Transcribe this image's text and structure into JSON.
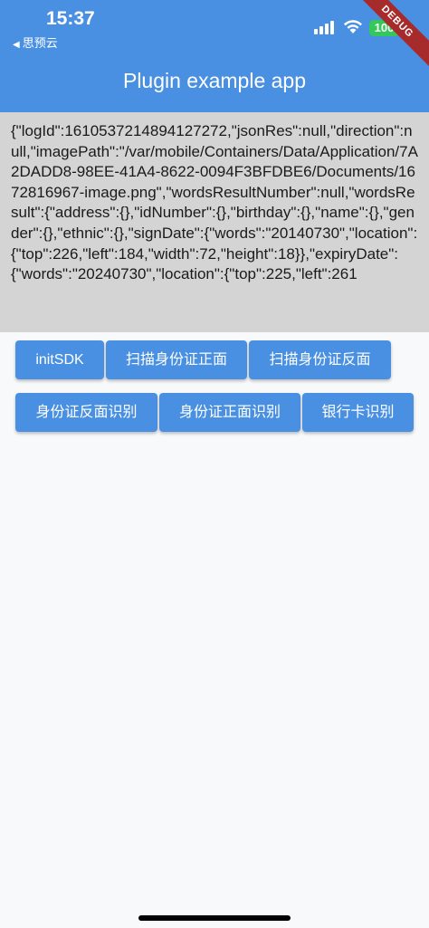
{
  "status_bar": {
    "time": "15:37",
    "back_app": "思预云",
    "back_arrow_icon": "back-triangle-icon",
    "signal_icon": "cellular-signal-icon",
    "wifi_icon": "wifi-icon",
    "battery": "100"
  },
  "debug_banner": "DEBUG",
  "app_bar": {
    "title": "Plugin example app",
    "color": "#4a90e2"
  },
  "result": {
    "text": "{\"logId\":1610537214894127272,\"jsonRes\":null,\"direction\":null,\"imagePath\":\"/var/mobile/Containers/Data/Application/7A2DADD8-98EE-41A4-8622-0094F3BFDBE6/Documents/1672816967-image.png\",\"wordsResultNumber\":null,\"wordsResult\":{\"address\":{},\"idNumber\":{},\"birthday\":{},\"name\":{},\"gender\":{},\"ethnic\":{},\"signDate\":{\"words\":\"20140730\",\"location\":{\"top\":226,\"left\":184,\"width\":72,\"height\":18}},\"expiryDate\":{\"words\":\"20240730\",\"location\":{\"top\":225,\"left\":261"
  },
  "buttons": {
    "init_sdk": "initSDK",
    "scan_front": "扫描身份证正面",
    "scan_back": "扫描身份证反面",
    "recognize_back": "身份证反面识别",
    "recognize_front": "身份证正面识别",
    "bank_card": "银行卡识别"
  }
}
